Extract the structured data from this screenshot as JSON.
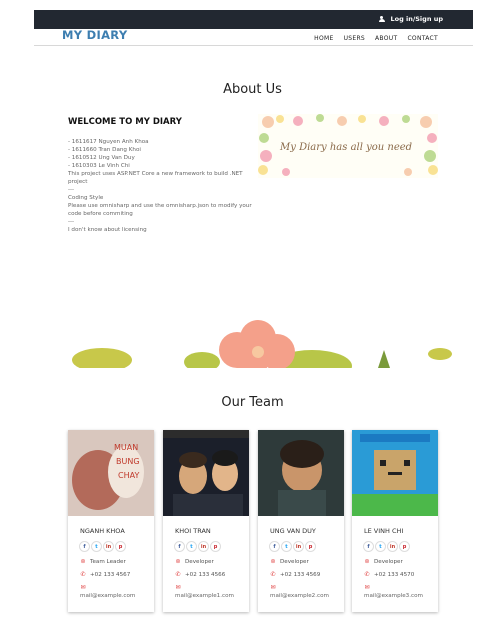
{
  "header": {
    "login_label": "Log in/Sign up"
  },
  "nav": {
    "brand": "MY DIARY",
    "items": [
      "HOME",
      "USERS",
      "ABOUT",
      "CONTACT"
    ]
  },
  "about": {
    "title": "About Us",
    "heading": "WELCOME TO MY DIARY",
    "lines": [
      "- 1611617 Nguyen Anh Khoa",
      "- 1611660 Tran Dang Khoi",
      "- 1610512 Ung Van Duy",
      "- 1610303 Le Vinh Chi",
      "This project uses ASP.NET Core a new framework to build .NET project",
      "---",
      "Coding Style",
      "Please use omnisharp and use the omnisharp.json to modify your code before commiting",
      "---",
      "I don't know about licensing"
    ],
    "banner_text": "My Diary has all you need"
  },
  "team": {
    "title": "Our Team",
    "members": [
      {
        "name": "NGANH KHOA",
        "role": "Team Leader",
        "phone": "+02 133 4567",
        "email": "mail@example.com"
      },
      {
        "name": "KHOI TRAN",
        "role": "Developer",
        "phone": "+02 133 4566",
        "email": "mail@example1.com"
      },
      {
        "name": "UNG VAN DUY",
        "role": "Developer",
        "phone": "+02 133 4569",
        "email": "mail@example2.com"
      },
      {
        "name": "LE VINH CHI",
        "role": "Developer",
        "phone": "+02 133 4570",
        "email": "mail@example3.com"
      }
    ],
    "social_icons": [
      "facebook-icon",
      "twitter-icon",
      "linkedin-icon",
      "pinterest-icon"
    ]
  },
  "colors": {
    "topbar": "#222831",
    "brand": "#3d7eb0",
    "icon_accent": "#e04444"
  }
}
